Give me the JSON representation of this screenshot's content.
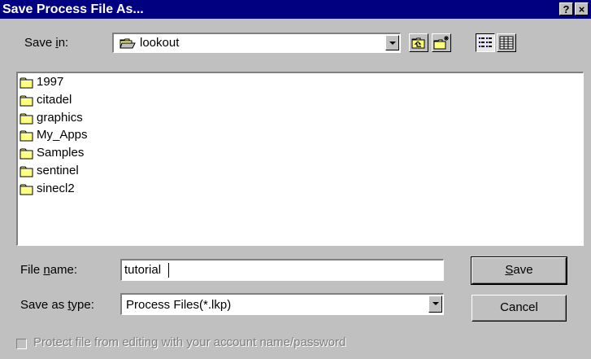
{
  "window": {
    "title": "Save Process File As...",
    "help_glyph": "?",
    "close_glyph": "×"
  },
  "toolbar": {
    "save_in_label_pre": "Save ",
    "save_in_label_key": "i",
    "save_in_label_post": "n:",
    "save_in_value": "lookout",
    "icons": [
      "up-one-level-icon",
      "create-new-folder-icon",
      "list-view-icon",
      "details-view-icon"
    ]
  },
  "files": [
    {
      "name": "1997"
    },
    {
      "name": "citadel"
    },
    {
      "name": "graphics"
    },
    {
      "name": "My_Apps"
    },
    {
      "name": "Samples"
    },
    {
      "name": "sentinel"
    },
    {
      "name": "sinecl2"
    }
  ],
  "form": {
    "filename_label_pre": "File ",
    "filename_label_key": "n",
    "filename_label_post": "ame:",
    "filename_value": "tutorial",
    "savetype_label_pre": "Save as ",
    "savetype_label_key": "t",
    "savetype_label_post": "ype:",
    "savetype_value": "Process Files(*.lkp)"
  },
  "buttons": {
    "save_key": "S",
    "save_rest": "ave",
    "cancel": "Cancel"
  },
  "protect": {
    "label": "Protect file from editing with your account name/password",
    "checked": false,
    "enabled": false
  },
  "colors": {
    "titlebar": "#000080",
    "face": "#c0c0c0",
    "folder": "#ffff80"
  }
}
